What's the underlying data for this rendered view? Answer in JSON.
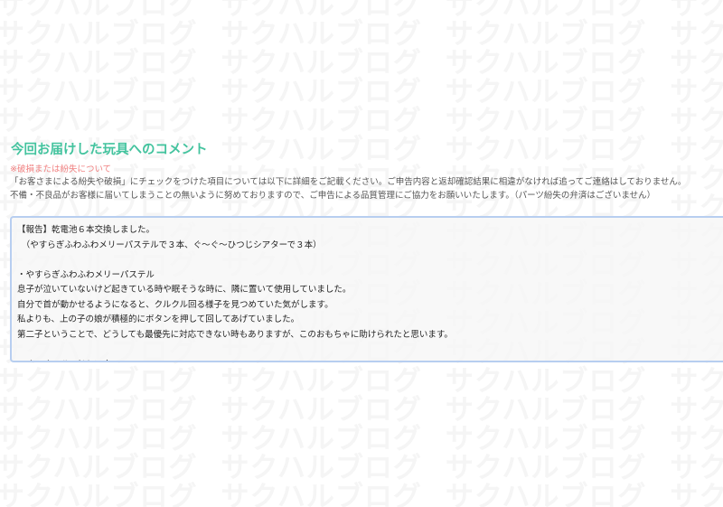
{
  "watermark": {
    "text": "サクハルブログ",
    "color": "#f5f5f5"
  },
  "section": {
    "title": "今回お届けした玩具へのコメント",
    "title_color": "#43c39e",
    "note_red": "※破損または紛失について",
    "note_red_color": "#f08080",
    "desc_line1": "「お客さまによる紛失や破損」にチェックをつけた項目については以下に詳細をご記載ください。ご申告内容と返却確認結果に相違がなければ追ってご連絡はしておりません。",
    "desc_line2": "不備・不良品がお客様に届いてしまうことの無いように努めておりますので、ご申告による品質管理にご協力をお願いいたします。（パーツ紛失の弁済はございません）"
  },
  "comment": {
    "lines": [
      "【報告】乾電池６本交換しました。",
      "　（やすらぎふわふわメリーパステルで３本、ぐ〜ぐ〜ひつじシアターで３本）",
      "",
      "・やすらぎふわふわメリーパステル",
      "息子が泣いていないけど起きている時や眠そうな時に、隣に置いて使用していました。",
      "自分で首が動かせるようになると、クルクル回る様子を見つめていた気がします。",
      "私よりも、上の子の娘が積極的にボタンを押して回してあげていました。",
      "第二子ということで、どうしても最優先に対応できない時もありますが、このおもちゃに助けられたと思います。",
      "",
      "・ぐ〜ぐ〜ひつじシアター"
    ],
    "border_color": "#b7cef0"
  }
}
